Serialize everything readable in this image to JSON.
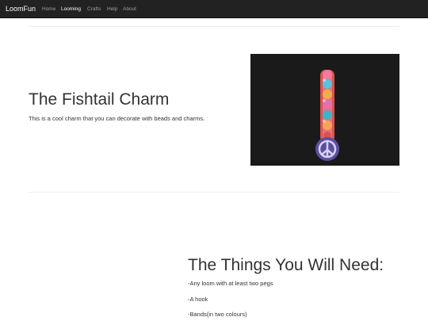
{
  "navbar": {
    "brand": "LoomFun",
    "items": [
      {
        "label": "Home",
        "active": false
      },
      {
        "label": "Looming",
        "active": true
      },
      {
        "label": "Crafts",
        "active": false
      },
      {
        "label": "Help",
        "active": false
      },
      {
        "label": "About",
        "active": false
      }
    ]
  },
  "section1": {
    "title": "The Fishtail Charm",
    "description": "This is a cool charm that you can decorate with beads and charms."
  },
  "section2": {
    "title": "The Things You Will Need:",
    "items": [
      "-Any loom with at least two pegs",
      "-A hook",
      "-Bands(in two colours)"
    ]
  },
  "colors": {
    "navbar_bg": "#222222",
    "nav_text": "#9d9d9d",
    "nav_active": "#ffffff",
    "text": "#333333",
    "divider": "#eeeeee"
  }
}
